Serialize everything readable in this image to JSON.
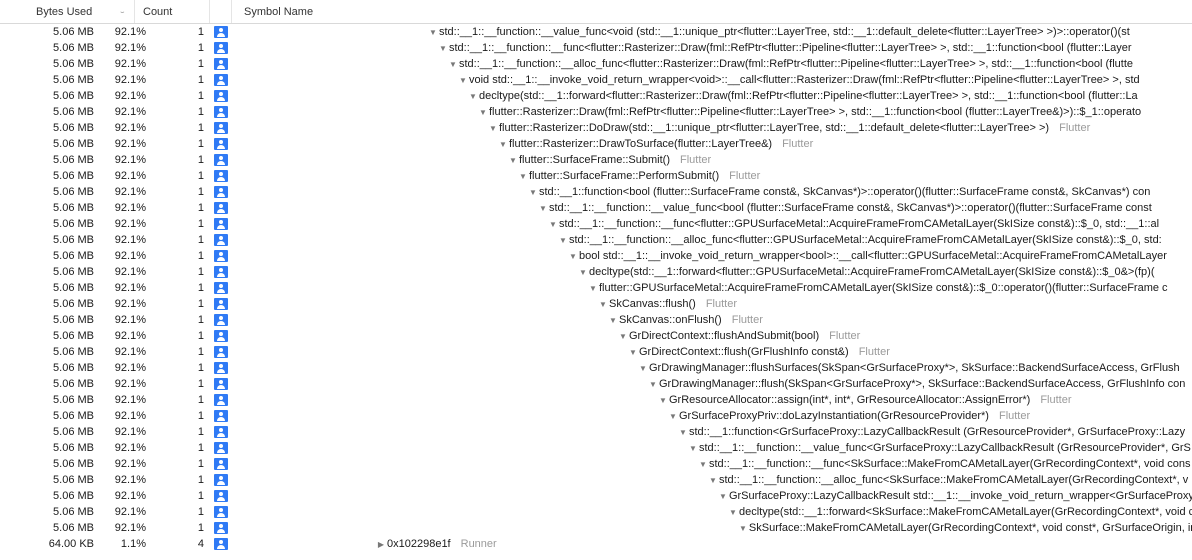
{
  "header": {
    "bytes_label": "Bytes Used",
    "count_label": "Count",
    "symbol_label": "Symbol Name"
  },
  "rows": [
    {
      "bytes": "5.06 MB",
      "pct": "92.1%",
      "count": "1",
      "indent": 432,
      "disclosure": "down",
      "symbol": "std::__1::__function::__value_func<void (std::__1::unique_ptr<flutter::LayerTree, std::__1::default_delete<flutter::LayerTree> >)>::operator()(st",
      "module": ""
    },
    {
      "bytes": "5.06 MB",
      "pct": "92.1%",
      "count": "1",
      "indent": 442,
      "disclosure": "down",
      "symbol": "std::__1::__function::__func<flutter::Rasterizer::Draw(fml::RefPtr<flutter::Pipeline<flutter::LayerTree> >, std::__1::function<bool (flutter::Layer",
      "module": ""
    },
    {
      "bytes": "5.06 MB",
      "pct": "92.1%",
      "count": "1",
      "indent": 452,
      "disclosure": "down",
      "symbol": "std::__1::__function::__alloc_func<flutter::Rasterizer::Draw(fml::RefPtr<flutter::Pipeline<flutter::LayerTree> >, std::__1::function<bool (flutte",
      "module": ""
    },
    {
      "bytes": "5.06 MB",
      "pct": "92.1%",
      "count": "1",
      "indent": 462,
      "disclosure": "down",
      "symbol": "void std::__1::__invoke_void_return_wrapper<void>::__call<flutter::Rasterizer::Draw(fml::RefPtr<flutter::Pipeline<flutter::LayerTree> >, std",
      "module": ""
    },
    {
      "bytes": "5.06 MB",
      "pct": "92.1%",
      "count": "1",
      "indent": 472,
      "disclosure": "down",
      "symbol": "decltype(std::__1::forward<flutter::Rasterizer::Draw(fml::RefPtr<flutter::Pipeline<flutter::LayerTree> >, std::__1::function<bool (flutter::La",
      "module": ""
    },
    {
      "bytes": "5.06 MB",
      "pct": "92.1%",
      "count": "1",
      "indent": 482,
      "disclosure": "down",
      "symbol": "flutter::Rasterizer::Draw(fml::RefPtr<flutter::Pipeline<flutter::LayerTree> >, std::__1::function<bool (flutter::LayerTree&)>)::$_1::operato",
      "module": ""
    },
    {
      "bytes": "5.06 MB",
      "pct": "92.1%",
      "count": "1",
      "indent": 492,
      "disclosure": "down",
      "symbol": "flutter::Rasterizer::DoDraw(std::__1::unique_ptr<flutter::LayerTree, std::__1::default_delete<flutter::LayerTree> >)",
      "module": "Flutter"
    },
    {
      "bytes": "5.06 MB",
      "pct": "92.1%",
      "count": "1",
      "indent": 502,
      "disclosure": "down",
      "symbol": "flutter::Rasterizer::DrawToSurface(flutter::LayerTree&)",
      "module": "Flutter"
    },
    {
      "bytes": "5.06 MB",
      "pct": "92.1%",
      "count": "1",
      "indent": 512,
      "disclosure": "down",
      "symbol": "flutter::SurfaceFrame::Submit()",
      "module": "Flutter"
    },
    {
      "bytes": "5.06 MB",
      "pct": "92.1%",
      "count": "1",
      "indent": 522,
      "disclosure": "down",
      "symbol": "flutter::SurfaceFrame::PerformSubmit()",
      "module": "Flutter"
    },
    {
      "bytes": "5.06 MB",
      "pct": "92.1%",
      "count": "1",
      "indent": 532,
      "disclosure": "down",
      "symbol": "std::__1::function<bool (flutter::SurfaceFrame const&, SkCanvas*)>::operator()(flutter::SurfaceFrame const&, SkCanvas*) con",
      "module": ""
    },
    {
      "bytes": "5.06 MB",
      "pct": "92.1%",
      "count": "1",
      "indent": 542,
      "disclosure": "down",
      "symbol": "std::__1::__function::__value_func<bool (flutter::SurfaceFrame const&, SkCanvas*)>::operator()(flutter::SurfaceFrame const",
      "module": ""
    },
    {
      "bytes": "5.06 MB",
      "pct": "92.1%",
      "count": "1",
      "indent": 552,
      "disclosure": "down",
      "symbol": "std::__1::__function::__func<flutter::GPUSurfaceMetal::AcquireFrameFromCAMetalLayer(SkISize const&)::$_0, std::__1::al",
      "module": ""
    },
    {
      "bytes": "5.06 MB",
      "pct": "92.1%",
      "count": "1",
      "indent": 562,
      "disclosure": "down",
      "symbol": "std::__1::__function::__alloc_func<flutter::GPUSurfaceMetal::AcquireFrameFromCAMetalLayer(SkISize const&)::$_0, std:",
      "module": ""
    },
    {
      "bytes": "5.06 MB",
      "pct": "92.1%",
      "count": "1",
      "indent": 572,
      "disclosure": "down",
      "symbol": "bool std::__1::__invoke_void_return_wrapper<bool>::__call<flutter::GPUSurfaceMetal::AcquireFrameFromCAMetalLayer",
      "module": ""
    },
    {
      "bytes": "5.06 MB",
      "pct": "92.1%",
      "count": "1",
      "indent": 582,
      "disclosure": "down",
      "symbol": "decltype(std::__1::forward<flutter::GPUSurfaceMetal::AcquireFrameFromCAMetalLayer(SkISize const&)::$_0&>(fp)(",
      "module": ""
    },
    {
      "bytes": "5.06 MB",
      "pct": "92.1%",
      "count": "1",
      "indent": 592,
      "disclosure": "down",
      "symbol": "flutter::GPUSurfaceMetal::AcquireFrameFromCAMetalLayer(SkISize const&)::$_0::operator()(flutter::SurfaceFrame c",
      "module": ""
    },
    {
      "bytes": "5.06 MB",
      "pct": "92.1%",
      "count": "1",
      "indent": 602,
      "disclosure": "down",
      "symbol": "SkCanvas::flush()",
      "module": "Flutter"
    },
    {
      "bytes": "5.06 MB",
      "pct": "92.1%",
      "count": "1",
      "indent": 612,
      "disclosure": "down",
      "symbol": "SkCanvas::onFlush()",
      "module": "Flutter"
    },
    {
      "bytes": "5.06 MB",
      "pct": "92.1%",
      "count": "1",
      "indent": 622,
      "disclosure": "down",
      "symbol": "GrDirectContext::flushAndSubmit(bool)",
      "module": "Flutter"
    },
    {
      "bytes": "5.06 MB",
      "pct": "92.1%",
      "count": "1",
      "indent": 632,
      "disclosure": "down",
      "symbol": "GrDirectContext::flush(GrFlushInfo const&)",
      "module": "Flutter"
    },
    {
      "bytes": "5.06 MB",
      "pct": "92.1%",
      "count": "1",
      "indent": 642,
      "disclosure": "down",
      "symbol": "GrDrawingManager::flushSurfaces(SkSpan<GrSurfaceProxy*>, SkSurface::BackendSurfaceAccess, GrFlush",
      "module": ""
    },
    {
      "bytes": "5.06 MB",
      "pct": "92.1%",
      "count": "1",
      "indent": 652,
      "disclosure": "down",
      "symbol": "GrDrawingManager::flush(SkSpan<GrSurfaceProxy*>, SkSurface::BackendSurfaceAccess, GrFlushInfo con",
      "module": ""
    },
    {
      "bytes": "5.06 MB",
      "pct": "92.1%",
      "count": "1",
      "indent": 662,
      "disclosure": "down",
      "symbol": "GrResourceAllocator::assign(int*, int*, GrResourceAllocator::AssignError*)",
      "module": "Flutter"
    },
    {
      "bytes": "5.06 MB",
      "pct": "92.1%",
      "count": "1",
      "indent": 672,
      "disclosure": "down",
      "symbol": "GrSurfaceProxyPriv::doLazyInstantiation(GrResourceProvider*)",
      "module": "Flutter"
    },
    {
      "bytes": "5.06 MB",
      "pct": "92.1%",
      "count": "1",
      "indent": 682,
      "disclosure": "down",
      "symbol": "std::__1::function<GrSurfaceProxy::LazyCallbackResult (GrResourceProvider*, GrSurfaceProxy::Lazy",
      "module": ""
    },
    {
      "bytes": "5.06 MB",
      "pct": "92.1%",
      "count": "1",
      "indent": 692,
      "disclosure": "down",
      "symbol": "std::__1::__function::__value_func<GrSurfaceProxy::LazyCallbackResult (GrResourceProvider*, GrS",
      "module": ""
    },
    {
      "bytes": "5.06 MB",
      "pct": "92.1%",
      "count": "1",
      "indent": 702,
      "disclosure": "down",
      "symbol": "std::__1::__function::__func<SkSurface::MakeFromCAMetalLayer(GrRecordingContext*, void cons",
      "module": ""
    },
    {
      "bytes": "5.06 MB",
      "pct": "92.1%",
      "count": "1",
      "indent": 712,
      "disclosure": "down",
      "symbol": "std::__1::__function::__alloc_func<SkSurface::MakeFromCAMetalLayer(GrRecordingContext*, v",
      "module": ""
    },
    {
      "bytes": "5.06 MB",
      "pct": "92.1%",
      "count": "1",
      "indent": 722,
      "disclosure": "down",
      "symbol": "GrSurfaceProxy::LazyCallbackResult std::__1::__invoke_void_return_wrapper<GrSurfaceProxy",
      "module": ""
    },
    {
      "bytes": "5.06 MB",
      "pct": "92.1%",
      "count": "1",
      "indent": 732,
      "disclosure": "down",
      "symbol": "decltype(std::__1::forward<SkSurface::MakeFromCAMetalLayer(GrRecordingContext*, void c",
      "module": ""
    },
    {
      "bytes": "5.06 MB",
      "pct": "92.1%",
      "count": "1",
      "indent": 742,
      "disclosure": "down",
      "symbol": "SkSurface::MakeFromCAMetalLayer(GrRecordingContext*, void const*, GrSurfaceOrigin, in",
      "module": ""
    },
    {
      "bytes": "64.00 KB",
      "pct": "1.1%",
      "count": "4",
      "indent": 250,
      "disclosure": "right",
      "symbol": "0x102298e1f",
      "module": "Runner",
      "noicon": false
    }
  ]
}
